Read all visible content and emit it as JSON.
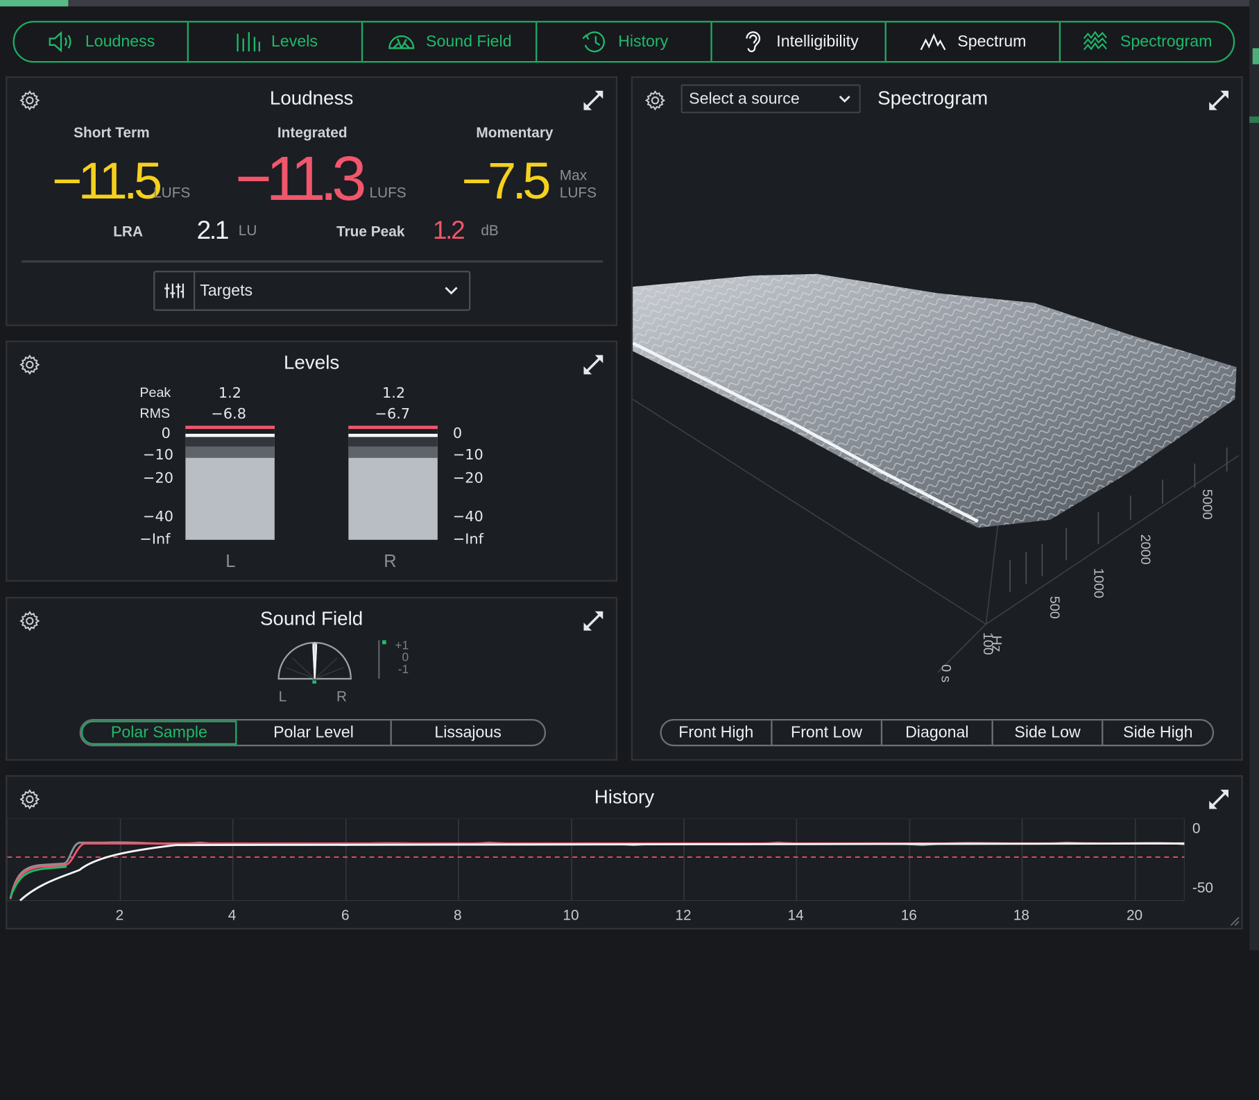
{
  "top_progress_fraction": 0.054,
  "nav": {
    "tabs": [
      {
        "label": "Loudness",
        "icon": "speaker-icon",
        "color": "green"
      },
      {
        "label": "Levels",
        "icon": "levels-icon",
        "color": "green"
      },
      {
        "label": "Sound Field",
        "icon": "soundfield-icon",
        "color": "green"
      },
      {
        "label": "History",
        "icon": "history-icon",
        "color": "green"
      },
      {
        "label": "Intelligibility",
        "icon": "ear-icon",
        "color": "white"
      },
      {
        "label": "Spectrum",
        "icon": "spectrum-icon",
        "color": "white"
      },
      {
        "label": "Spectrogram",
        "icon": "spectrogram-icon",
        "color": "green"
      }
    ]
  },
  "loudness": {
    "title": "Loudness",
    "short_term": {
      "label": "Short Term",
      "value": "−11.5",
      "unit": "LUFS"
    },
    "integrated": {
      "label": "Integrated",
      "value": "−11.3",
      "unit": "LUFS"
    },
    "momentary": {
      "label": "Momentary",
      "value": "−7.5",
      "unit_top": "Max",
      "unit": "LUFS"
    },
    "lra": {
      "label": "LRA",
      "value": "2.1",
      "unit": "LU"
    },
    "true_peak": {
      "label": "True Peak",
      "value": "1.2",
      "unit": "dB"
    },
    "targets_label": "Targets"
  },
  "levels": {
    "title": "Levels",
    "peak_label": "Peak",
    "rms_label": "RMS",
    "left": {
      "peak": "1.2",
      "rms": "−6.8",
      "name": "L"
    },
    "right": {
      "peak": "1.2",
      "rms": "−6.7",
      "name": "R"
    },
    "scale": [
      "0",
      "−10",
      "−20",
      "−40",
      "−Inf"
    ]
  },
  "sound_field": {
    "title": "Sound Field",
    "left_label": "L",
    "right_label": "R",
    "corr_scale": [
      "+1",
      "0",
      "-1"
    ],
    "buttons": [
      "Polar Sample",
      "Polar Level",
      "Lissajous"
    ],
    "active_button": "Polar Sample"
  },
  "spectrogram": {
    "title": "Spectrogram",
    "source_placeholder": "Select a source",
    "freq_labels": [
      "100",
      "500",
      "1000",
      "2000",
      "5000"
    ],
    "freq_unit": "Hz",
    "time_label": "0 s",
    "views": [
      "Front High",
      "Front Low",
      "Diagonal",
      "Side Low",
      "Side High"
    ]
  },
  "history": {
    "title": "History",
    "y_labels": [
      "0",
      "-50"
    ],
    "x_labels": [
      "2",
      "4",
      "6",
      "8",
      "10",
      "12",
      "14",
      "16",
      "18",
      "20"
    ]
  },
  "colors": {
    "accent_green": "#1fab63",
    "loud_yellow": "#f5d11e",
    "loud_red": "#f1566c"
  }
}
